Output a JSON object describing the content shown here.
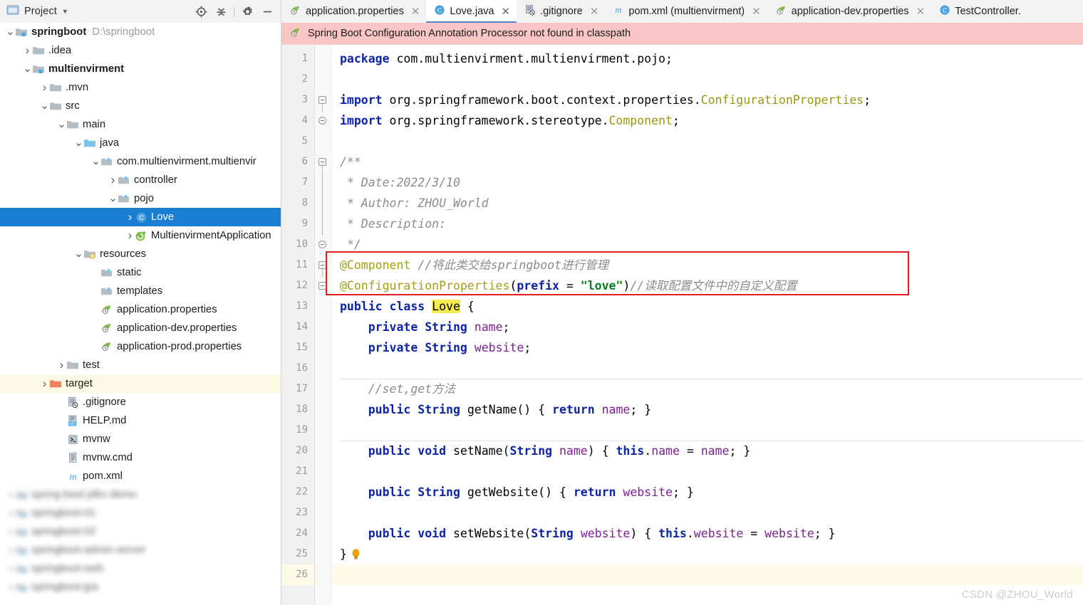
{
  "window": {
    "project_panel_title": "Project",
    "watermark": "CSDN @ZHOU_World"
  },
  "toolbar": {
    "icons": [
      {
        "name": "locate-icon",
        "label": "Select Opened File"
      },
      {
        "name": "collapse-all-icon",
        "label": "Collapse All"
      },
      {
        "name": "gear-icon",
        "label": "Settings"
      },
      {
        "name": "minimize-icon",
        "label": "Hide"
      }
    ]
  },
  "tabs": [
    {
      "label": "application.properties",
      "icon": "spring-properties-icon",
      "active": false
    },
    {
      "label": "Love.java",
      "icon": "java-class-icon",
      "active": true
    },
    {
      "label": ".gitignore",
      "icon": "gitignore-icon",
      "active": false
    },
    {
      "label": "pom.xml (multienvirment)",
      "icon": "maven-icon",
      "active": false
    },
    {
      "label": "application-dev.properties",
      "icon": "spring-properties-icon",
      "active": false
    },
    {
      "label": "TestController.",
      "icon": "java-class-icon",
      "active": false
    }
  ],
  "notification": {
    "icon": "spring-leaf-icon",
    "message": "Spring Boot Configuration Annotation Processor not found in classpath",
    "bg_color": "#fac5c5"
  },
  "project_tree": [
    {
      "label": "springboot",
      "path": "D:\\springboot",
      "indent": 0,
      "arrow": "down",
      "icon": "module-icon",
      "bold": true,
      "state": "normal"
    },
    {
      "label": ".idea",
      "path": "",
      "indent": 1,
      "arrow": "right",
      "icon": "folder-icon",
      "bold": false,
      "state": "normal"
    },
    {
      "label": "multienvirment",
      "path": "",
      "indent": 1,
      "arrow": "down",
      "icon": "module-icon",
      "bold": true,
      "state": "normal"
    },
    {
      "label": ".mvn",
      "path": "",
      "indent": 2,
      "arrow": "right",
      "icon": "folder-icon",
      "bold": false,
      "state": "normal"
    },
    {
      "label": "src",
      "path": "",
      "indent": 2,
      "arrow": "down",
      "icon": "folder-icon",
      "bold": false,
      "state": "normal"
    },
    {
      "label": "main",
      "path": "",
      "indent": 3,
      "arrow": "down",
      "icon": "folder-icon",
      "bold": false,
      "state": "normal"
    },
    {
      "label": "java",
      "path": "",
      "indent": 4,
      "arrow": "down",
      "icon": "source-folder-icon",
      "bold": false,
      "state": "normal"
    },
    {
      "label": "com.multienvirment.multienvir",
      "path": "",
      "indent": 5,
      "arrow": "down",
      "icon": "package-icon",
      "bold": false,
      "state": "normal"
    },
    {
      "label": "controller",
      "path": "",
      "indent": 6,
      "arrow": "right",
      "icon": "package-icon",
      "bold": false,
      "state": "normal"
    },
    {
      "label": "pojo",
      "path": "",
      "indent": 6,
      "arrow": "down",
      "icon": "package-icon",
      "bold": false,
      "state": "normal"
    },
    {
      "label": "Love",
      "path": "",
      "indent": 7,
      "arrow": "right",
      "icon": "java-class-icon",
      "bold": false,
      "state": "selected"
    },
    {
      "label": "MultienvirmentApplication",
      "path": "",
      "indent": 7,
      "arrow": "right",
      "icon": "spring-app-icon",
      "bold": false,
      "state": "normal"
    },
    {
      "label": "resources",
      "path": "",
      "indent": 4,
      "arrow": "down",
      "icon": "resources-folder-icon",
      "bold": false,
      "state": "normal"
    },
    {
      "label": "static",
      "path": "",
      "indent": 5,
      "arrow": "none",
      "icon": "package-icon",
      "bold": false,
      "state": "normal"
    },
    {
      "label": "templates",
      "path": "",
      "indent": 5,
      "arrow": "none",
      "icon": "package-icon",
      "bold": false,
      "state": "normal"
    },
    {
      "label": "application.properties",
      "path": "",
      "indent": 5,
      "arrow": "none",
      "icon": "spring-properties-icon",
      "bold": false,
      "state": "normal"
    },
    {
      "label": "application-dev.properties",
      "path": "",
      "indent": 5,
      "arrow": "none",
      "icon": "spring-properties-icon",
      "bold": false,
      "state": "normal"
    },
    {
      "label": "application-prod.properties",
      "path": "",
      "indent": 5,
      "arrow": "none",
      "icon": "spring-properties-icon",
      "bold": false,
      "state": "normal"
    },
    {
      "label": "test",
      "path": "",
      "indent": 3,
      "arrow": "right",
      "icon": "folder-icon",
      "bold": false,
      "state": "normal"
    },
    {
      "label": "target",
      "path": "",
      "indent": 2,
      "arrow": "right",
      "icon": "target-folder-icon",
      "bold": false,
      "state": "highlight"
    },
    {
      "label": ".gitignore",
      "path": "",
      "indent": 3,
      "arrow": "none",
      "icon": "gitignore-icon",
      "bold": false,
      "state": "normal"
    },
    {
      "label": "HELP.md",
      "path": "",
      "indent": 3,
      "arrow": "none",
      "icon": "markdown-icon",
      "bold": false,
      "state": "normal"
    },
    {
      "label": "mvnw",
      "path": "",
      "indent": 3,
      "arrow": "none",
      "icon": "script-icon",
      "bold": false,
      "state": "normal"
    },
    {
      "label": "mvnw.cmd",
      "path": "",
      "indent": 3,
      "arrow": "none",
      "icon": "cmd-icon",
      "bold": false,
      "state": "normal"
    },
    {
      "label": "pom.xml",
      "path": "",
      "indent": 3,
      "arrow": "none",
      "icon": "maven-icon",
      "bold": false,
      "state": "normal"
    },
    {
      "label": "spring-boot-jdbc-demo",
      "path": "",
      "indent": 0,
      "arrow": "right",
      "icon": "module-icon",
      "bold": false,
      "state": "blurred"
    },
    {
      "label": "springboot-01",
      "path": "",
      "indent": 0,
      "arrow": "right",
      "icon": "module-icon",
      "bold": false,
      "state": "blurred"
    },
    {
      "label": "springboot-02",
      "path": "",
      "indent": 0,
      "arrow": "right",
      "icon": "module-icon",
      "bold": false,
      "state": "blurred"
    },
    {
      "label": "springboot-admin-server",
      "path": "",
      "indent": 0,
      "arrow": "right",
      "icon": "module-icon",
      "bold": false,
      "state": "blurred"
    },
    {
      "label": "springboot-web",
      "path": "",
      "indent": 0,
      "arrow": "right",
      "icon": "module-icon",
      "bold": false,
      "state": "blurred"
    },
    {
      "label": "springboot-jpa",
      "path": "",
      "indent": 0,
      "arrow": "right",
      "icon": "module-icon",
      "bold": false,
      "state": "blurred"
    }
  ],
  "editor": {
    "file": "Love.java",
    "line_count": 26,
    "caret_line": 26,
    "highlighted_identifier": "Love",
    "lines": [
      {
        "n": 1,
        "text": "package com.multienvirment.multienvirment.pojo;"
      },
      {
        "n": 2,
        "text": ""
      },
      {
        "n": 3,
        "text": "import org.springframework.boot.context.properties.ConfigurationProperties;"
      },
      {
        "n": 4,
        "text": "import org.springframework.stereotype.Component;"
      },
      {
        "n": 5,
        "text": ""
      },
      {
        "n": 6,
        "text": "/**"
      },
      {
        "n": 7,
        "text": " * Date:2022/3/10"
      },
      {
        "n": 8,
        "text": " * Author: ZHOU_World"
      },
      {
        "n": 9,
        "text": " * Description:"
      },
      {
        "n": 10,
        "text": " */"
      },
      {
        "n": 11,
        "text": "@Component //将此类交给springboot进行管理"
      },
      {
        "n": 12,
        "text": "@ConfigurationProperties(prefix = \"love\")//读取配置文件中的自定义配置"
      },
      {
        "n": 13,
        "text": "public class Love {"
      },
      {
        "n": 14,
        "text": "    private String name;"
      },
      {
        "n": 15,
        "text": "    private String website;"
      },
      {
        "n": 16,
        "text": ""
      },
      {
        "n": 17,
        "text": "    //set,get方法"
      },
      {
        "n": 18,
        "text": "    public String getName() { return name; }"
      },
      {
        "n": 19,
        "text": ""
      },
      {
        "n": 20,
        "text": "    public void setName(String name) { this.name = name; }"
      },
      {
        "n": 21,
        "text": ""
      },
      {
        "n": 22,
        "text": "    public String getWebsite() { return website; }"
      },
      {
        "n": 23,
        "text": ""
      },
      {
        "n": 24,
        "text": "    public void setWebsite(String website) { this.website = website; }"
      },
      {
        "n": 25,
        "text": "}"
      },
      {
        "n": 26,
        "text": ""
      }
    ],
    "annotation_box": {
      "color": "#e02020",
      "covers_lines": [
        11,
        12
      ],
      "note": "red rectangle highlighting the two Spring annotations"
    }
  }
}
